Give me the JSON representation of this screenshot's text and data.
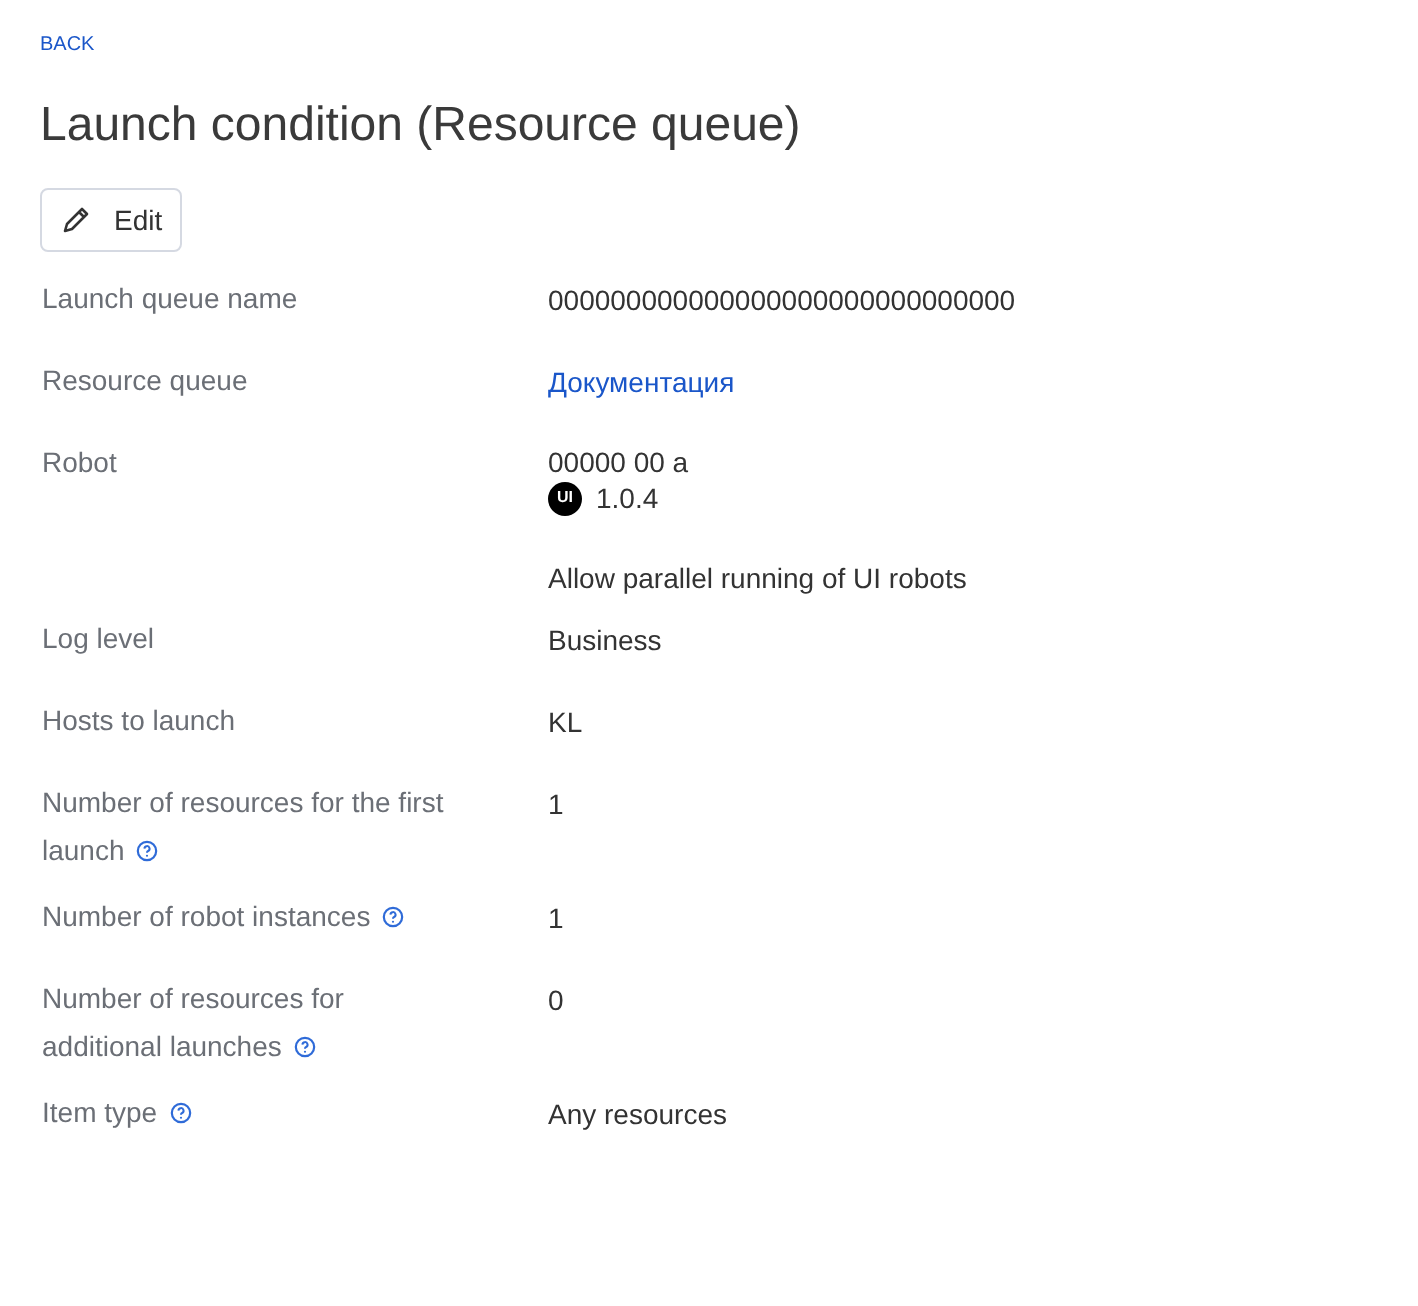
{
  "back": "BACK",
  "title": "Launch condition (Resource queue)",
  "edit_button": "Edit",
  "rows": [
    {
      "label": "Launch queue name",
      "help": false,
      "kind": "text",
      "value": "000000000000000000000000000000"
    },
    {
      "label": "Resource queue",
      "help": false,
      "kind": "link",
      "value": "Документация"
    },
    {
      "label": "Robot",
      "help": false,
      "kind": "robot",
      "value": "00000 00 a",
      "badge": "UI",
      "version": "1.0.4",
      "note": "Allow parallel running of UI robots"
    },
    {
      "label": "Log level",
      "help": false,
      "kind": "text",
      "value": "Business"
    },
    {
      "label": "Hosts to launch",
      "help": false,
      "kind": "text",
      "value": "KL"
    },
    {
      "label": "Number of resources for the first launch",
      "help": true,
      "kind": "text",
      "value": "1"
    },
    {
      "label": "Number of robot instances",
      "help": true,
      "kind": "text",
      "value": "1"
    },
    {
      "label": "Number of resources for additional launches",
      "help": true,
      "kind": "text",
      "value": "0"
    },
    {
      "label": "Item type",
      "help": true,
      "kind": "text",
      "value": "Any resources"
    }
  ]
}
